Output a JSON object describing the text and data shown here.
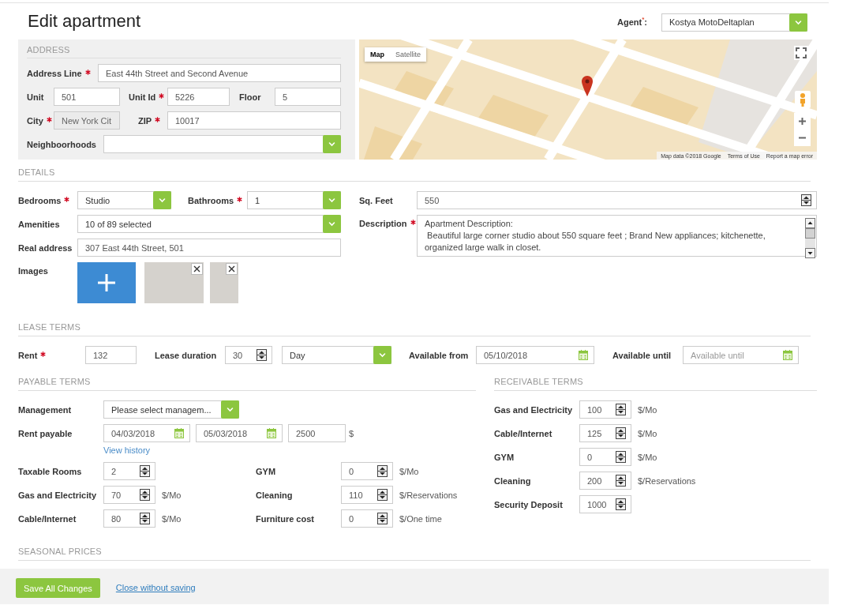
{
  "header": {
    "title": "Edit apartment",
    "agent": {
      "label": "Agent$^{*}$:",
      "value": "Kostya MotoDeltaplan"
    }
  },
  "address": {
    "heading": "ADDRESS",
    "rows": [
      [
        {
          "label": "Address Line",
          "required": true,
          "disabled": false,
          "kind": "text",
          "value": "East 44th Street and Second Avenue"
        }
      ],
      [
        {
          "label": "Unit",
          "required": false,
          "disabled": false,
          "kind": "text",
          "value": "501"
        },
        {
          "label": "Unit Id",
          "required": true,
          "disabled": false,
          "kind": "text",
          "value": "5226"
        },
        {
          "label": "Floor",
          "required": false,
          "disabled": false,
          "kind": "text",
          "value": "5"
        }
      ],
      [
        {
          "label": "City",
          "required": true,
          "disabled": true,
          "kind": "text",
          "value": "New York Cit"
        },
        {
          "label": "ZIP",
          "required": true,
          "disabled": false,
          "kind": "text",
          "value": "10017"
        }
      ],
      [
        {
          "label": "Neighboorhoods",
          "required": false,
          "disabled": false,
          "kind": "select"
        }
      ]
    ]
  },
  "map": {
    "map_types": [
      {
        "label": "Map",
        "selected": true
      },
      {
        "label": "Satellite",
        "selected": false
      }
    ],
    "attribution": [
      "Map data ©2018 Google",
      "Terms of Use",
      "Report a map error"
    ]
  },
  "details": {
    "heading": "DETAILS",
    "left_fields": [
      {
        "label": "Bedrooms",
        "required": true,
        "kind": "select",
        "value": "Studio"
      },
      {
        "label": "Bathrooms",
        "required": true,
        "kind": "select",
        "value": "1"
      },
      {
        "label": "Amenities",
        "required": false,
        "kind": "select",
        "value": "10 of 89 selected"
      },
      {
        "label": "Real address",
        "required": false,
        "kind": "text",
        "value": "307 East 44th Street, 501"
      }
    ],
    "images": {
      "label": "Images",
      "photos": [
        {
          "kind": "wide"
        },
        {
          "kind": "narrow"
        }
      ]
    },
    "right_fields": [
      {
        "label": "Sq. Feet",
        "required": false,
        "kind": "number",
        "value": "550"
      },
      {
        "label": "Description",
        "required": true,
        "kind": "textarea",
        "value": "Apartment Description:\n Beautiful large corner studio about 550 square feet ; Brand New appliances; kitchenette, organized large walk in closet."
      }
    ]
  },
  "lease": {
    "heading": "LEASE TERMS",
    "fields": [
      {
        "label": "Rent",
        "required": true,
        "kind": "text",
        "value": "132"
      },
      {
        "label": "Lease duration",
        "required": false,
        "kind": "number",
        "value": "30"
      },
      {
        "kind": "select",
        "value": "Day"
      },
      {
        "label": "Available from",
        "required": false,
        "kind": "date",
        "value": "05/10/2018"
      },
      {
        "label": "Available until",
        "required": false,
        "kind": "date",
        "placeholder": "Available until"
      }
    ]
  },
  "payable": {
    "heading": "PAYABLE TERMS",
    "management": {
      "label": "Management",
      "kind": "select",
      "value": "Please select managem..."
    },
    "rent_payable": {
      "label": "Rent payable",
      "fields": [
        {
          "kind": "date",
          "value": "04/03/2018"
        },
        {
          "kind": "date",
          "value": "05/03/2018"
        },
        {
          "kind": "text",
          "value": "2500"
        }
      ],
      "unit": "$",
      "link": "View history"
    },
    "charges": [
      {
        "label": "Taxable Rooms",
        "value": "2"
      },
      {
        "label": "GYM",
        "value": "0",
        "unit": "$/Mo"
      },
      {
        "label": "Gas and Electricity",
        "value": "70",
        "unit": "$/Mo"
      },
      {
        "label": "Cleaning",
        "value": "110",
        "unit": "$/Reservations"
      },
      {
        "label": "Cable/Internet",
        "value": "80",
        "unit": "$/Mo"
      },
      {
        "label": "Furniture cost",
        "value": "0",
        "unit": "$/One time"
      }
    ]
  },
  "receivable": {
    "heading": "RECEIVABLE TERMS",
    "charges": [
      {
        "label": "Gas and Electricity",
        "value": "100",
        "unit": "$/Mo"
      },
      {
        "label": "Cable/Internet",
        "value": "125",
        "unit": "$/Mo"
      },
      {
        "label": "GYM",
        "value": "0",
        "unit": "$/Mo"
      },
      {
        "label": "Cleaning",
        "value": "200",
        "unit": "$/Reservations"
      },
      {
        "label": "Security Deposit",
        "value": "1000"
      }
    ]
  },
  "seasonal": {
    "heading": "SEASONAL PRICES"
  },
  "footer": {
    "save_button": "Save All Changes",
    "close_link": "Close without saving"
  }
}
